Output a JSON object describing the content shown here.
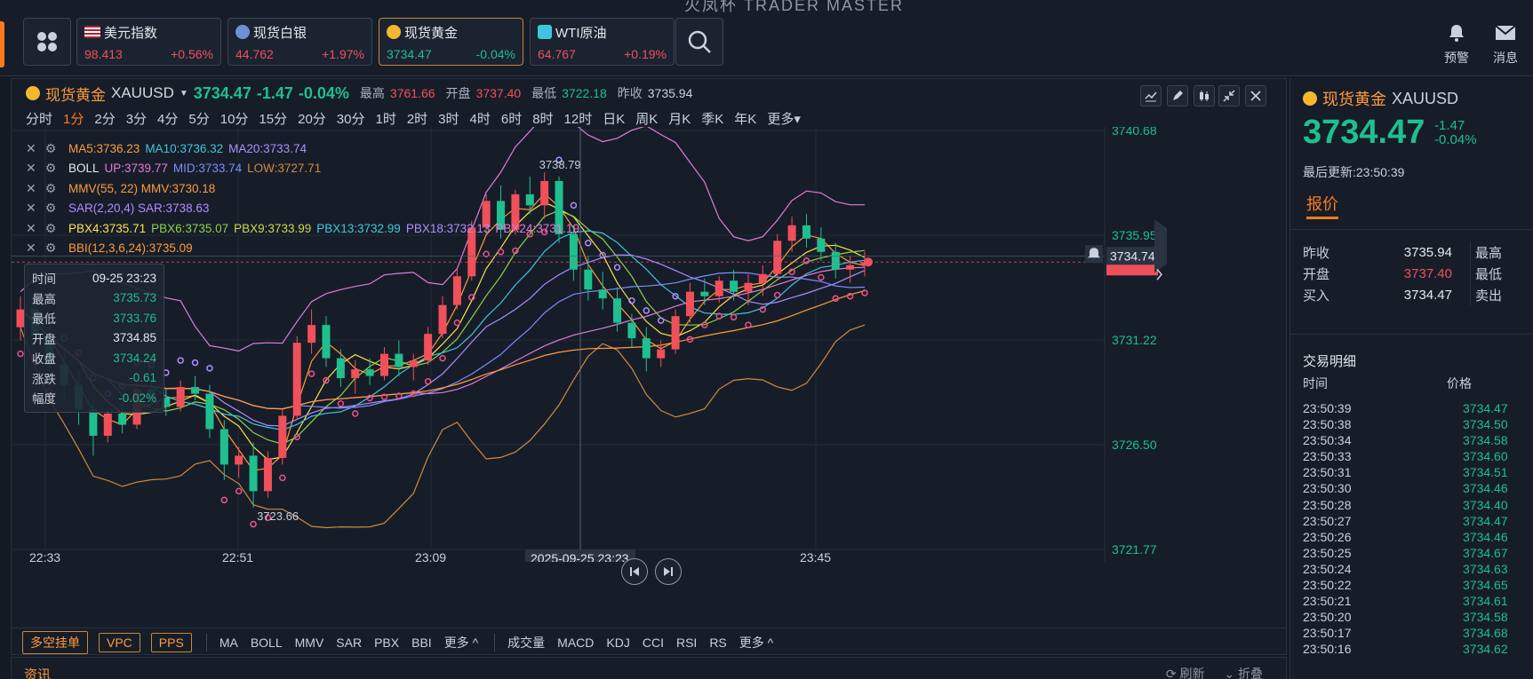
{
  "app": {
    "title": "火凤杯 TRADER MASTER"
  },
  "tickers": [
    {
      "name": "美元指数",
      "price": "98.413",
      "change": "+0.56%",
      "dir": "up",
      "icon": "us-flag-icon"
    },
    {
      "name": "现货白银",
      "price": "44.762",
      "change": "+1.97%",
      "dir": "up",
      "icon": "silver-coin-icon"
    },
    {
      "name": "现货黄金",
      "price": "3734.47",
      "change": "-0.04%",
      "dir": "dn",
      "icon": "gold-coin-icon"
    },
    {
      "name": "WTI原油",
      "price": "64.767",
      "change": "+0.19%",
      "dir": "up",
      "icon": "oil-icon"
    }
  ],
  "top_right": {
    "alert": "预警",
    "message": "消息"
  },
  "chart_header": {
    "name": "现货黄金",
    "symbol": "XAUUSD",
    "price": "3734.47",
    "change": "-1.47",
    "change_pct": "-0.04%",
    "high_label": "最高",
    "high": "3761.66",
    "open_label": "开盘",
    "open": "3737.40",
    "low_label": "最低",
    "low": "3722.18",
    "prev_label": "昨收",
    "prev": "3735.94"
  },
  "periods": [
    "分时",
    "1分",
    "2分",
    "3分",
    "4分",
    "5分",
    "10分",
    "15分",
    "20分",
    "30分",
    "1时",
    "2时",
    "3时",
    "4时",
    "6时",
    "8时",
    "12时",
    "日K",
    "周K",
    "月K",
    "季K",
    "年K",
    "更多"
  ],
  "active_period": "1分",
  "indicators": [
    [
      {
        "t": "MA5:3736.23",
        "c": "#ff9a3c"
      },
      {
        "t": "MA10:3736.32",
        "c": "#3ec6e0"
      },
      {
        "t": "MA20:3733.74",
        "c": "#b08cff"
      }
    ],
    [
      {
        "t": "BOLL",
        "c": "#e6e9ee"
      },
      {
        "t": "UP:3739.77",
        "c": "#e27ad8"
      },
      {
        "t": "MID:3733.74",
        "c": "#7b8cff"
      },
      {
        "t": "LOW:3727.71",
        "c": "#d08a3c"
      }
    ],
    [
      {
        "t": "MMV(55, 22) MMV:3730.18",
        "c": "#ff9a3c"
      }
    ],
    [
      {
        "t": "SAR(2,20,4) SAR:3738.63",
        "c": "#b08cff"
      }
    ],
    [
      {
        "t": "PBX4:3735.71",
        "c": "#ffe14a"
      },
      {
        "t": "PBX6:3735.07",
        "c": "#8fd14a"
      },
      {
        "t": "PBX9:3733.99",
        "c": "#c8d84a"
      },
      {
        "t": "PBX13:3732.99",
        "c": "#3ec6e0"
      },
      {
        "t": "PBX18:3732.13",
        "c": "#b08cff"
      },
      {
        "t": "PBX24:3731.19",
        "c": "#e27ad8"
      }
    ],
    [
      {
        "t": "BBI(12,3,6,24):3735.09",
        "c": "#ff9a3c"
      }
    ]
  ],
  "tooltip": [
    {
      "k": "时间",
      "v": "09-25 23:23",
      "cls": "w"
    },
    {
      "k": "最高",
      "v": "3735.73",
      "cls": ""
    },
    {
      "k": "最低",
      "v": "3733.76",
      "cls": ""
    },
    {
      "k": "开盘",
      "v": "3734.85",
      "cls": "w"
    },
    {
      "k": "收盘",
      "v": "3734.24",
      "cls": ""
    },
    {
      "k": "涨跌",
      "v": "-0.61",
      "cls": ""
    },
    {
      "k": "幅度",
      "v": "-0.02%",
      "cls": ""
    }
  ],
  "chart_data": {
    "type": "candlestick",
    "y_ticks": [
      "3740.68",
      "3735.95",
      "3731.22",
      "3726.50",
      "3721.77"
    ],
    "x_ticks": [
      "22:33",
      "22:51",
      "23:09",
      "23:45"
    ],
    "ylim": [
      3721.77,
      3740.68
    ],
    "crosshair_time": "2025-09-25 23:23",
    "current_price_label": "3734.74",
    "annotations": {
      "high": "3738.79",
      "low": "3723.66"
    },
    "candles": [
      [
        3731.8,
        3733.2,
        3731.2,
        3732.6
      ],
      [
        3732.6,
        3732.9,
        3731.0,
        3731.4
      ],
      [
        3731.4,
        3731.8,
        3729.8,
        3730.1
      ],
      [
        3730.1,
        3730.7,
        3728.6,
        3729.2
      ],
      [
        3729.2,
        3729.9,
        3727.4,
        3728.1
      ],
      [
        3728.1,
        3728.6,
        3726.0,
        3726.9
      ],
      [
        3726.9,
        3728.2,
        3726.6,
        3727.9
      ],
      [
        3727.9,
        3728.4,
        3727.0,
        3727.4
      ],
      [
        3727.4,
        3729.3,
        3727.2,
        3729.0
      ],
      [
        3729.0,
        3729.5,
        3728.3,
        3728.6
      ],
      [
        3728.6,
        3729.0,
        3727.8,
        3728.2
      ],
      [
        3728.2,
        3729.4,
        3728.0,
        3729.1
      ],
      [
        3729.1,
        3729.6,
        3728.5,
        3728.8
      ],
      [
        3728.8,
        3729.2,
        3726.8,
        3727.2
      ],
      [
        3727.2,
        3727.6,
        3724.9,
        3725.6
      ],
      [
        3725.6,
        3726.4,
        3725.0,
        3726.0
      ],
      [
        3726.0,
        3726.6,
        3723.66,
        3724.4
      ],
      [
        3724.4,
        3726.2,
        3724.1,
        3725.9
      ],
      [
        3725.9,
        3728.1,
        3725.6,
        3727.8
      ],
      [
        3727.8,
        3731.4,
        3727.6,
        3731.1
      ],
      [
        3731.1,
        3732.6,
        3730.6,
        3731.9
      ],
      [
        3731.9,
        3732.3,
        3730.0,
        3730.4
      ],
      [
        3730.4,
        3730.8,
        3729.1,
        3729.5
      ],
      [
        3729.5,
        3730.3,
        3728.8,
        3729.9
      ],
      [
        3729.9,
        3730.4,
        3729.2,
        3729.6
      ],
      [
        3729.6,
        3730.9,
        3729.4,
        3730.6
      ],
      [
        3730.6,
        3731.2,
        3729.6,
        3730.0
      ],
      [
        3730.0,
        3730.6,
        3729.4,
        3730.3
      ],
      [
        3730.3,
        3731.8,
        3730.1,
        3731.5
      ],
      [
        3731.5,
        3733.2,
        3731.3,
        3732.8
      ],
      [
        3732.8,
        3734.4,
        3732.6,
        3734.1
      ],
      [
        3734.1,
        3736.6,
        3733.9,
        3736.3
      ],
      [
        3736.3,
        3737.8,
        3736.0,
        3737.5
      ],
      [
        3737.5,
        3738.2,
        3735.8,
        3736.2
      ],
      [
        3736.2,
        3738.0,
        3736.0,
        3737.8
      ],
      [
        3737.8,
        3738.6,
        3736.9,
        3737.3
      ],
      [
        3737.3,
        3738.79,
        3736.7,
        3738.4
      ],
      [
        3738.4,
        3738.6,
        3735.6,
        3736.0
      ],
      [
        3736.0,
        3736.4,
        3733.9,
        3734.4
      ],
      [
        3734.4,
        3735.0,
        3733.0,
        3733.5
      ],
      [
        3733.5,
        3734.3,
        3732.6,
        3733.1
      ],
      [
        3733.1,
        3733.6,
        3731.6,
        3732.0
      ],
      [
        3732.0,
        3732.4,
        3730.9,
        3731.3
      ],
      [
        3731.3,
        3731.8,
        3729.8,
        3730.4
      ],
      [
        3730.4,
        3731.2,
        3730.0,
        3730.8
      ],
      [
        3730.8,
        3732.6,
        3730.6,
        3732.3
      ],
      [
        3732.3,
        3733.8,
        3732.0,
        3733.4
      ],
      [
        3733.4,
        3734.0,
        3732.8,
        3733.2
      ],
      [
        3733.2,
        3734.1,
        3732.9,
        3733.9
      ],
      [
        3733.9,
        3734.4,
        3733.0,
        3733.4
      ],
      [
        3733.4,
        3734.2,
        3732.8,
        3733.8
      ],
      [
        3733.8,
        3734.6,
        3733.2,
        3734.2
      ],
      [
        3734.2,
        3736.0,
        3734.0,
        3735.7
      ],
      [
        3735.7,
        3736.8,
        3735.2,
        3736.4
      ],
      [
        3736.4,
        3736.9,
        3735.4,
        3735.8
      ],
      [
        3735.8,
        3736.3,
        3734.8,
        3735.2
      ],
      [
        3735.2,
        3735.6,
        3734.0,
        3734.4
      ],
      [
        3734.4,
        3735.0,
        3733.8,
        3734.6
      ],
      [
        3734.6,
        3735.2,
        3734.1,
        3734.74
      ]
    ]
  },
  "bottom_tools": {
    "buttons": [
      "多空挂单",
      "VPC",
      "PPS"
    ],
    "main_indicators": [
      "MA",
      "BOLL",
      "MMV",
      "SAR",
      "PBX",
      "BBI",
      "更多 ^"
    ],
    "sub_indicators": [
      "成交量",
      "MACD",
      "KDJ",
      "CCI",
      "RSI",
      "RS",
      "更多 ^"
    ]
  },
  "news": {
    "title": "资讯",
    "refresh": "刷新",
    "collapse": "折叠"
  },
  "right_panel": {
    "name": "现货黄金",
    "symbol": "XAUUSD",
    "price": "3734.47",
    "change": "-1.47",
    "change_pct": "-0.04%",
    "updated": "最后更新:23:50:39",
    "tab": "报价",
    "quote": [
      {
        "k": "昨收",
        "v": "3735.94",
        "cls": "w",
        "k2": "最高"
      },
      {
        "k": "开盘",
        "v": "3737.40",
        "cls": "up",
        "k2": "最低"
      },
      {
        "k": "买入",
        "v": "3734.47",
        "cls": "w",
        "k2": "卖出"
      }
    ],
    "trades_title": "交易明细",
    "trades_cols": {
      "time": "时间",
      "price": "价格"
    },
    "trades": [
      [
        "23:50:39",
        "3734.47"
      ],
      [
        "23:50:38",
        "3734.50"
      ],
      [
        "23:50:34",
        "3734.58"
      ],
      [
        "23:50:33",
        "3734.60"
      ],
      [
        "23:50:31",
        "3734.51"
      ],
      [
        "23:50:30",
        "3734.46"
      ],
      [
        "23:50:28",
        "3734.40"
      ],
      [
        "23:50:27",
        "3734.47"
      ],
      [
        "23:50:26",
        "3734.46"
      ],
      [
        "23:50:25",
        "3734.67"
      ],
      [
        "23:50:24",
        "3734.63"
      ],
      [
        "23:50:22",
        "3734.65"
      ],
      [
        "23:50:21",
        "3734.61"
      ],
      [
        "23:50:20",
        "3734.58"
      ],
      [
        "23:50:17",
        "3734.68"
      ],
      [
        "23:50:16",
        "3734.62"
      ]
    ]
  },
  "colors": {
    "up": "#f0505a",
    "down": "#1fbf8f",
    "accent": "#ff7a1a"
  }
}
